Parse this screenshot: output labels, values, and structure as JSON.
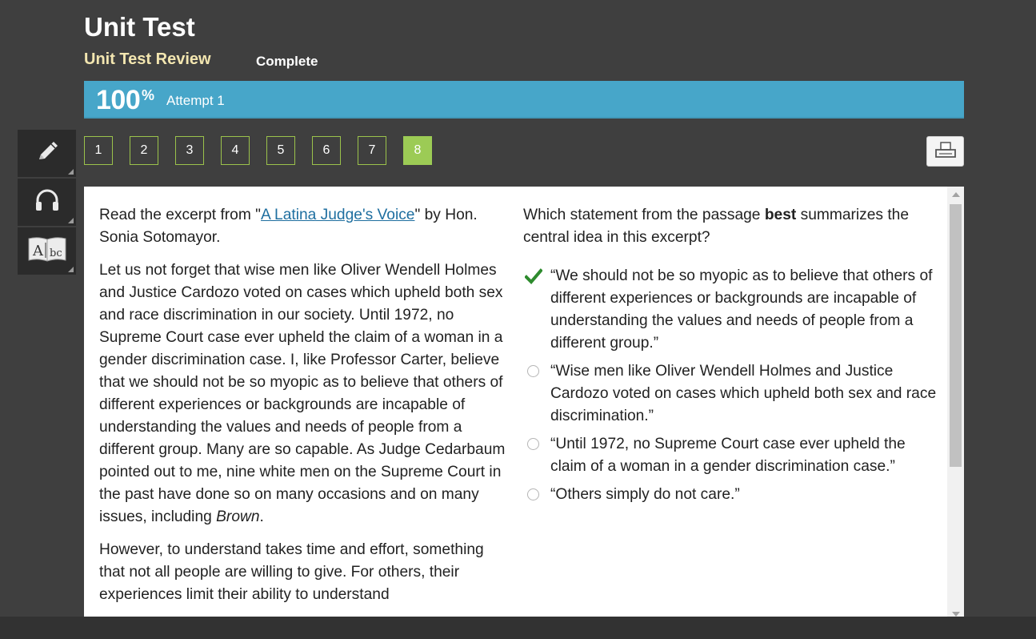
{
  "header": {
    "title": "Unit Test",
    "subtitle": "Unit Test Review",
    "status": "Complete"
  },
  "score": {
    "value": "100",
    "unit": "%",
    "attempt": "Attempt 1"
  },
  "tools": [
    {
      "name": "pencil-icon"
    },
    {
      "name": "headphones-icon"
    },
    {
      "name": "dictionary-icon"
    }
  ],
  "question_nav": {
    "items": [
      "1",
      "2",
      "3",
      "4",
      "5",
      "6",
      "7",
      "8"
    ],
    "active": "8"
  },
  "passage": {
    "intro_prefix": "Read the excerpt from \"",
    "intro_link": "A Latina Judge's Voice",
    "intro_suffix": "\" by Hon. Sonia Sotomayor.",
    "para1_main": "Let us not forget that wise men like Oliver Wendell Holmes and Justice Cardozo voted on cases which upheld both sex and race discrimination in our society. Until 1972, no Supreme Court case ever upheld the claim of a woman in a gender discrimination case. I, like Professor Carter, believe that we should not be so myopic as to believe that others of different experiences or backgrounds are incapable of understanding the values and needs of people from a different group. Many are so capable. As Judge Cedarbaum pointed out to me, nine white men on the Supreme Court in the past have done so on many occasions and on many issues, including ",
    "para1_italic": "Brown",
    "para1_end": ".",
    "para2": "However, to understand takes time and effort, something that not all people are willing to give. For others, their experiences limit their ability to understand"
  },
  "question": {
    "prefix": "Which statement from the passage ",
    "bold": "best",
    "suffix": " summarizes the central idea in this excerpt?"
  },
  "answers": [
    {
      "text": "“We should not be so myopic as to believe that others of different experiences or backgrounds are incapable of understanding the values and needs of people from a different group.”",
      "selected": true
    },
    {
      "text": "“Wise men like Oliver Wendell Holmes and Justice Cardozo voted on cases which upheld both sex and race discrimination.”",
      "selected": false
    },
    {
      "text": "“Until 1972, no Supreme Court case ever upheld the claim of a woman in a gender discrimination case.”",
      "selected": false
    },
    {
      "text": "“Others simply do not care.”",
      "selected": false
    }
  ],
  "colors": {
    "background": "#3f3f3f",
    "score_bar": "#47a6c9",
    "active_question": "#9ccb55",
    "subtitle": "#f3e6b0",
    "check": "#2e8b2e"
  }
}
